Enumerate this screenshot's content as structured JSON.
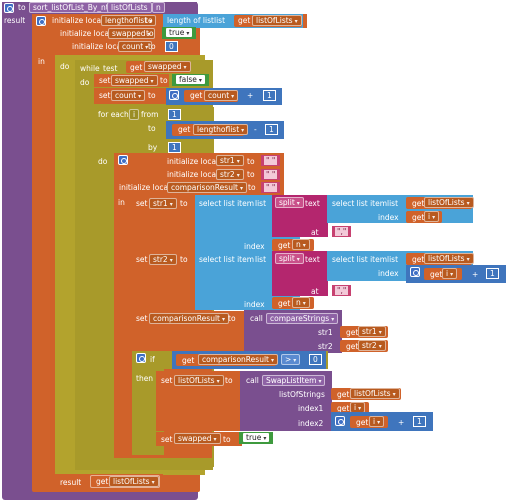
{
  "procedure": {
    "to_label": "to",
    "name": "sort_listOfList_By_nth_item",
    "param_list": "listOfLists",
    "param_n": "n",
    "result_label": "result"
  },
  "init1": {
    "label": "initialize local",
    "var": "lengthoflist",
    "to": "to",
    "value_label": "length of list",
    "list_label": "list",
    "get": "get",
    "get_var": "listOfLists"
  },
  "init2": {
    "label": "initialize local",
    "var": "swapped",
    "to": "to",
    "value": "true"
  },
  "init3": {
    "label": "initialize local",
    "var": "count",
    "to": "to",
    "value": "0"
  },
  "in_label": "in",
  "do_label": "do",
  "while": {
    "label": "while",
    "test_label": "test",
    "get": "get",
    "var": "swapped"
  },
  "set_swapped_false": {
    "set": "set",
    "var": "swapped",
    "to": "to",
    "value": "false"
  },
  "set_count": {
    "set": "set",
    "var": "count",
    "to": "to",
    "get": "get",
    "get_var": "count",
    "op": "+",
    "num": "1"
  },
  "for_each": {
    "label": "for each",
    "var": "i",
    "from": "from",
    "from_val": "1",
    "to": "to",
    "get": "get",
    "get_var": "lengthoflist",
    "op": "-",
    "num": "1",
    "by": "by",
    "by_val": "1"
  },
  "do2_label": "do",
  "init_str1": {
    "label": "initialize local",
    "var": "str1",
    "to": "to",
    "value": "\" \""
  },
  "init_str2": {
    "label": "initialize local",
    "var": "str2",
    "to": "to",
    "value": "\" \""
  },
  "init_cmp": {
    "label": "initialize local",
    "var": "comparisonResult",
    "to": "to",
    "value": "\" \""
  },
  "in2_label": "in",
  "set_str1": {
    "set": "set",
    "var": "str1",
    "to": "to",
    "select": "select list item",
    "list": "list",
    "split": "split",
    "text": "text",
    "select2": "select list item",
    "list2": "list",
    "get": "get",
    "get_list": "listOfLists",
    "index": "index",
    "get_i": "i",
    "at": "at",
    "at_val": "\",\"",
    "index2": "index",
    "get_n": "n"
  },
  "set_str2": {
    "set": "set",
    "var": "str2",
    "to": "to",
    "select": "select list item",
    "list": "list",
    "split": "split",
    "text": "text",
    "select2": "select list item",
    "list2": "list",
    "get": "get",
    "get_list": "listOfLists",
    "index": "index",
    "get_i": "i",
    "op": "+",
    "num": "1",
    "at": "at",
    "at_val": "\",\"",
    "index2": "index",
    "get_n": "n"
  },
  "set_cmp": {
    "set": "set",
    "var": "comparisonResult",
    "to": "to",
    "call": "call",
    "proc": "compareStrings",
    "str1_label": "str1",
    "str2_label": "str2",
    "get": "get",
    "v1": "str1",
    "v2": "str2"
  },
  "if_block": {
    "if": "if",
    "get": "get",
    "var": "comparisonResult",
    "op": ">",
    "num": "0",
    "then": "then"
  },
  "set_list": {
    "set": "set",
    "var": "listOfLists",
    "to": "to",
    "call": "call",
    "proc": "SwapListItem",
    "a1": "listOfStrings",
    "a2": "index1",
    "a3": "index2",
    "get": "get",
    "v1": "listOfLists",
    "v2": "i",
    "v3": "i",
    "op": "+",
    "num": "1"
  },
  "set_swapped_true": {
    "set": "set",
    "var": "swapped",
    "to": "to",
    "value": "true"
  },
  "result": {
    "label": "result",
    "get": "get",
    "var": "listOfLists"
  }
}
